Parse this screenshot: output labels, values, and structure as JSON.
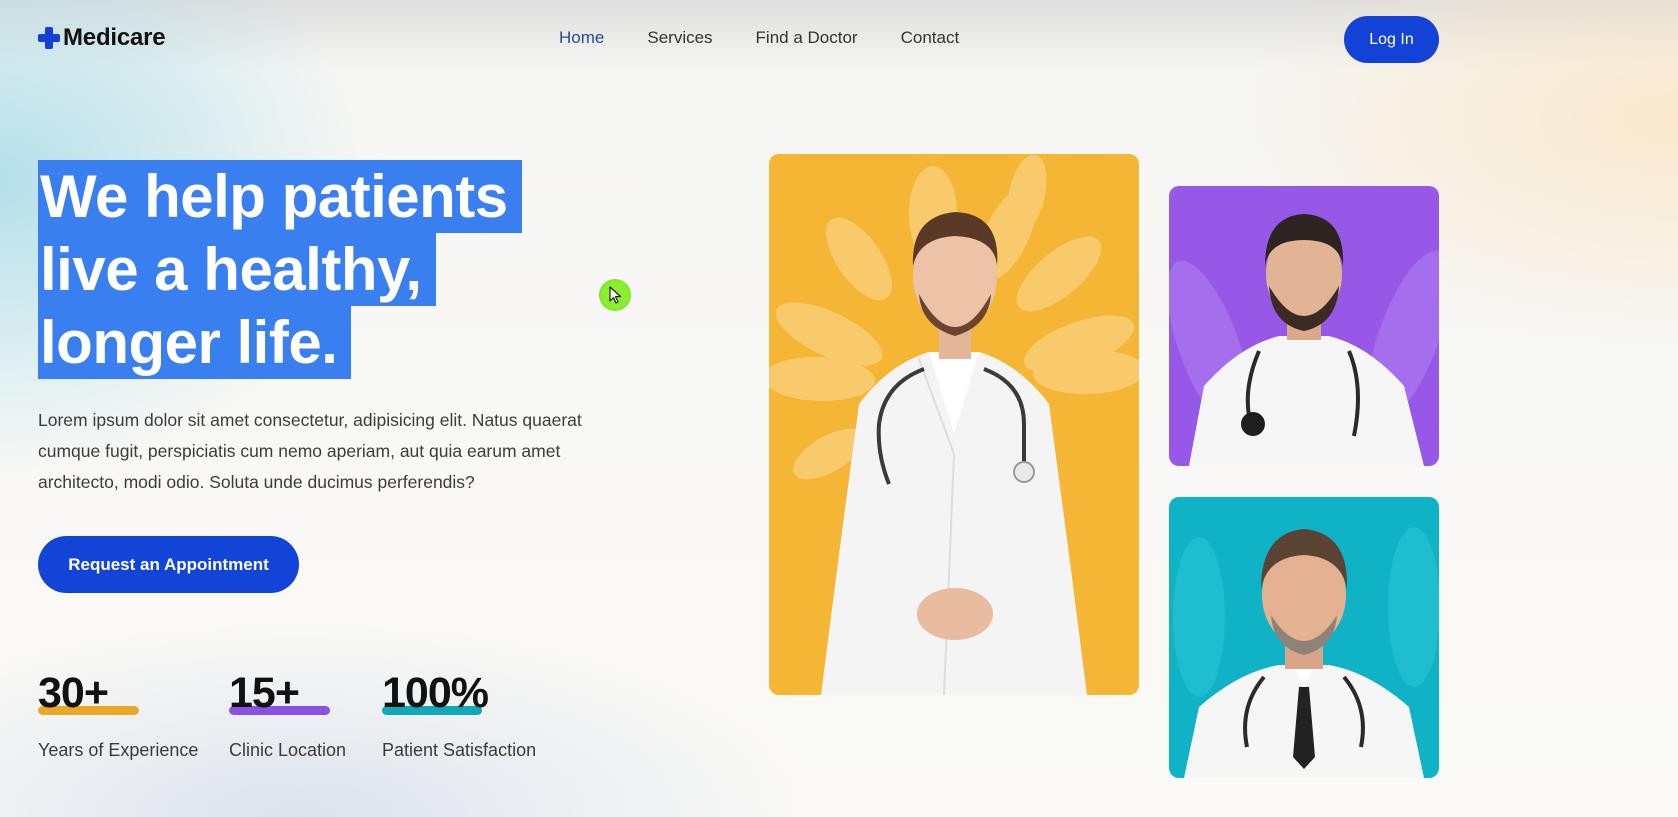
{
  "brand": {
    "name": "Medicare",
    "accent": "#1342d6"
  },
  "nav": {
    "items": [
      {
        "label": "Home",
        "active": true
      },
      {
        "label": "Services",
        "active": false
      },
      {
        "label": "Find a Doctor",
        "active": false
      },
      {
        "label": "Contact",
        "active": false
      }
    ],
    "login_label": "Log In"
  },
  "hero": {
    "headline_lines": [
      "We help patients",
      "live a healthy,",
      "longer life."
    ],
    "headline_selected": true,
    "description": "Lorem ipsum dolor sit amet consectetur, adipisicing elit. Natus quaerat cumque fugit, perspiciatis cum nemo aperiam, aut quia earum amet architecto, modi odio. Soluta unde ducimus perferendis?",
    "cta_label": "Request an Appointment"
  },
  "stats": [
    {
      "value": "30+",
      "label": "Years of Experience",
      "color": "#e9a826"
    },
    {
      "value": "15+",
      "label": "Clinic Location",
      "color": "#8b51e0"
    },
    {
      "value": "100%",
      "label": "Patient Satisfaction",
      "color": "#11a8b8"
    }
  ],
  "doctors": [
    {
      "card": "main",
      "background": "#f5b535"
    },
    {
      "card": "top-right",
      "background": "#9758e8"
    },
    {
      "card": "bottom-right",
      "background": "#10b2c6"
    }
  ]
}
